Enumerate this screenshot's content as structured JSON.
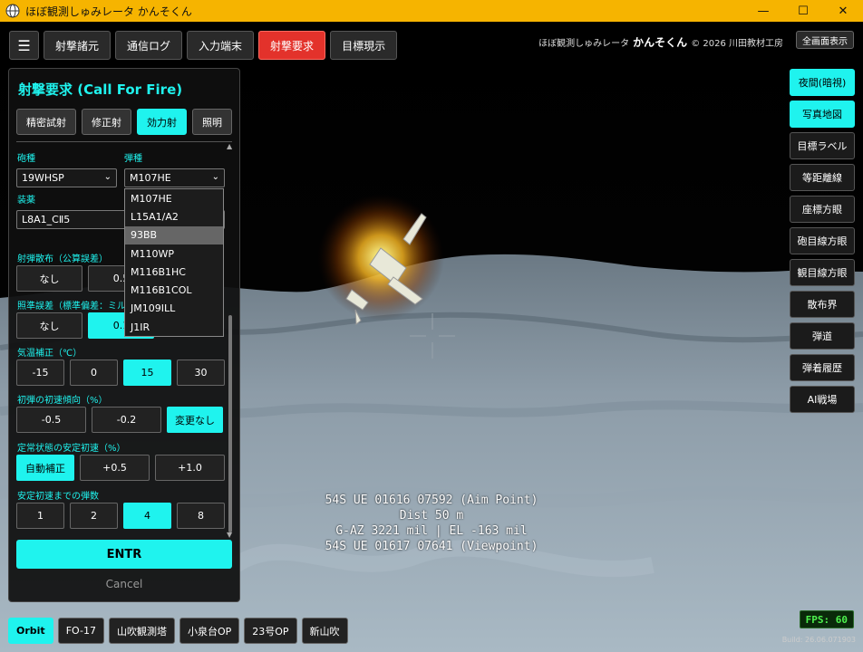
{
  "window": {
    "title": "ほぼ観測しゅみレータ かんそくん",
    "controls": {
      "minimize": "—",
      "maximize": "☐",
      "close": "✕"
    }
  },
  "toolbar": {
    "menu_glyph": "☰",
    "tabs": [
      {
        "label": "射撃諸元",
        "active": false
      },
      {
        "label": "通信ログ",
        "active": false
      },
      {
        "label": "入力端末",
        "active": false
      },
      {
        "label": "射撃要求",
        "active": true
      },
      {
        "label": "目標現示",
        "active": false
      }
    ]
  },
  "brand": {
    "prefix": "ほぼ観測しゅみレータ",
    "name": "かんそくん",
    "copyright": "© 2026 川田教材工房"
  },
  "fullscreen_label": "全画面表示",
  "right_buttons": [
    {
      "label": "夜間(暗視)",
      "active": true
    },
    {
      "label": "写真地図",
      "active": true
    },
    {
      "label": "目標ラベル",
      "active": false
    },
    {
      "label": "等距離線",
      "active": false
    },
    {
      "label": "座標方眼",
      "active": false
    },
    {
      "label": "砲目線方眼",
      "active": false
    },
    {
      "label": "観目線方眼",
      "active": false
    },
    {
      "label": "散布界",
      "active": false
    },
    {
      "label": "弾道",
      "active": false
    },
    {
      "label": "弾着履歴",
      "active": false
    },
    {
      "label": "AI戦場",
      "active": false
    }
  ],
  "panel": {
    "title": "射撃要求 (Call For Fire)",
    "modes": [
      {
        "label": "精密試射",
        "active": false
      },
      {
        "label": "修正射",
        "active": false
      },
      {
        "label": "効力射",
        "active": true
      },
      {
        "label": "照明",
        "active": false
      }
    ],
    "gun_type": {
      "label": "砲種",
      "value": "19WHSP"
    },
    "ammo_type": {
      "label": "弾種",
      "value": "M107HE"
    },
    "charge": {
      "label": "装薬",
      "value": "L8A1_CⅡ5"
    },
    "dispersion": {
      "label": "射弾散布（公算誤差）",
      "options": [
        "なし",
        "0.5"
      ],
      "selected": "なし"
    },
    "aim_error": {
      "label": "照準誤差（標準偏差：ミル）",
      "options": [
        "なし",
        "0.1"
      ],
      "selected": "0.1"
    },
    "temp": {
      "label": "気温補正（℃）",
      "options": [
        "-15",
        "0",
        "15",
        "30"
      ],
      "selected": "15"
    },
    "initial_velocity": {
      "label": "初弾の初速傾向（%）",
      "options": [
        "-0.5",
        "-0.2",
        "変更なし"
      ],
      "selected": "変更なし"
    },
    "steady_velocity": {
      "label": "定常状態の安定初速（%）",
      "options": [
        "自動補正",
        "+0.5",
        "+1.0"
      ],
      "selected": "自動補正"
    },
    "rounds_to_stable": {
      "label": "安定初速までの弾数",
      "options": [
        "1",
        "2",
        "4",
        "8"
      ],
      "selected": "4"
    },
    "entr_label": "ENTR",
    "cancel_label": "Cancel"
  },
  "ammo_dropdown": {
    "options": [
      "M107HE",
      "L15A1/A2",
      "93BB",
      "M110WP",
      "M116B1HC",
      "M116B1COL",
      "JM109ILL",
      "J1IR"
    ],
    "highlighted": "93BB"
  },
  "readout": {
    "line1": "54S UE 01616 07592 (Aim Point)",
    "line2": "Dist 50 m",
    "line3": "G-AZ 3221 mil | EL -163 mil",
    "line4": "54S UE 01617 07641 (Viewpoint)"
  },
  "viewpoints": [
    {
      "label": "Orbit",
      "active": true
    },
    {
      "label": "FO-17",
      "active": false
    },
    {
      "label": "山吹観測塔",
      "active": false
    },
    {
      "label": "小泉台OP",
      "active": false
    },
    {
      "label": "23号OP",
      "active": false
    },
    {
      "label": "新山吹",
      "active": false
    }
  ],
  "fps_label": "FPS: 60",
  "build_label": "Build: 26.06.071903",
  "colors": {
    "accent": "#1ff3ee",
    "alert": "#e3322b",
    "titlebar": "#f6b400",
    "fps": "#4ef24e"
  }
}
